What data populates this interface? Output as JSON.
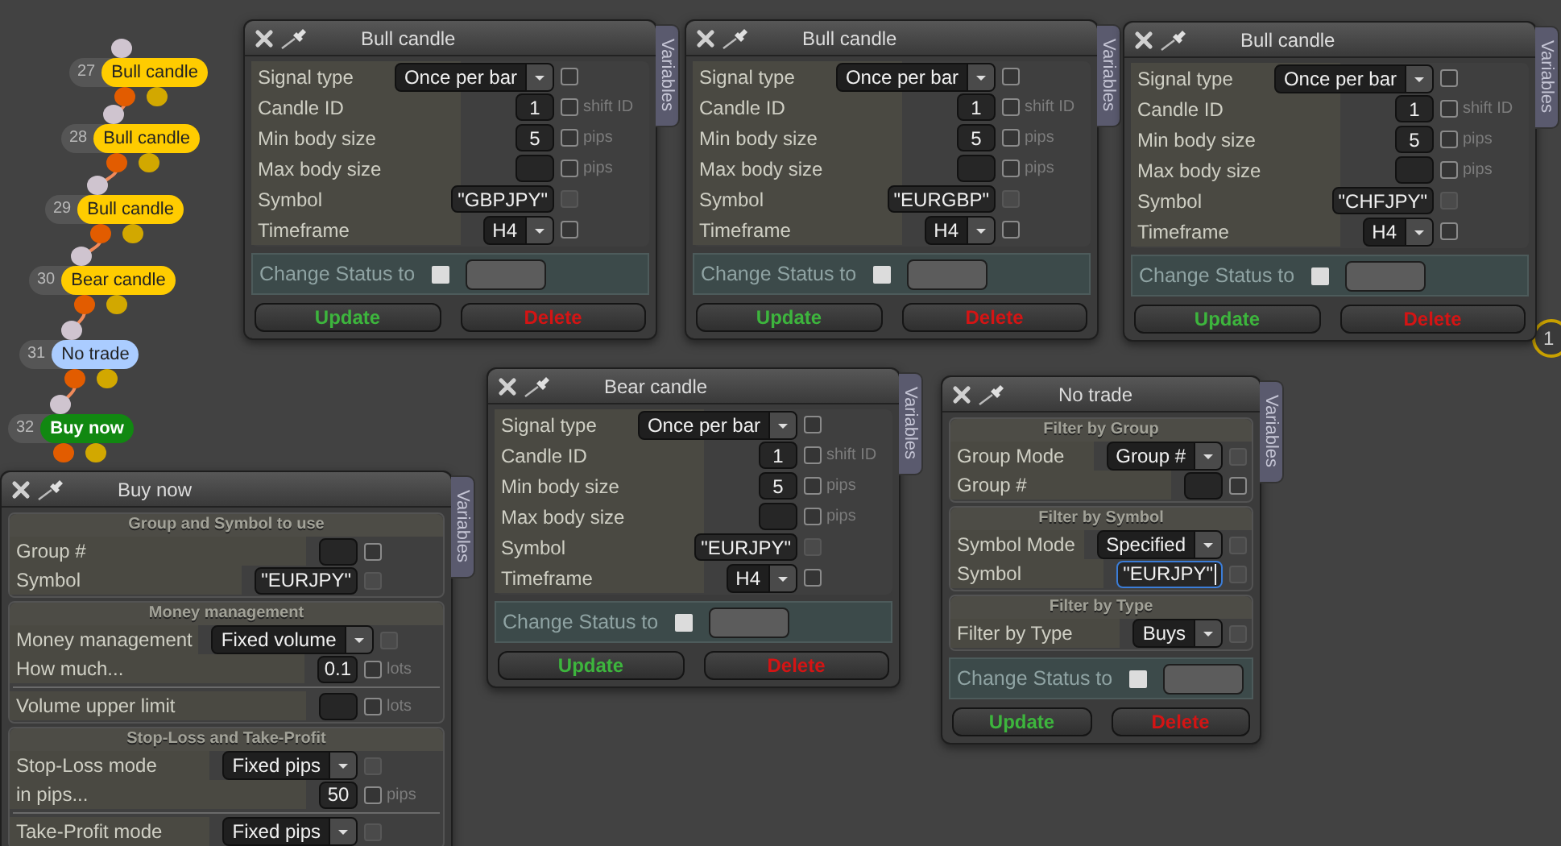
{
  "nodes": [
    {
      "number": "27",
      "label": "Bull candle",
      "color": "#ffcc00"
    },
    {
      "number": "28",
      "label": "Bull candle",
      "color": "#ffcc00"
    },
    {
      "number": "29",
      "label": "Bull candle",
      "color": "#ffcc00"
    },
    {
      "number": "30",
      "label": "Bear candle",
      "color": "#ffcc00"
    },
    {
      "number": "31",
      "label": "No trade",
      "color": "#aaccff"
    },
    {
      "number": "32",
      "label": "Buy now",
      "color": "#118811"
    }
  ],
  "edge_node": {
    "number": "1"
  },
  "windows": [
    {
      "title": "Bull candle",
      "kind": "candle",
      "tab": "Variables",
      "sections": [
        {
          "rows": [
            {
              "kind": "dropdown",
              "label": "Signal type",
              "value": "Once per bar",
              "checked": false,
              "disabled": false
            },
            {
              "kind": "input",
              "label": "Candle ID",
              "value": "1",
              "focused": false,
              "checked": false,
              "disabled": false,
              "unit": "shift ID"
            },
            {
              "kind": "input",
              "label": "Min body size",
              "value": "5",
              "focused": false,
              "checked": false,
              "disabled": false,
              "unit": "pips"
            },
            {
              "kind": "input",
              "label": "Max body size",
              "focused": false,
              "checked": false,
              "disabled": false,
              "unit": "pips"
            },
            {
              "kind": "input",
              "label": "Symbol",
              "value": "\"GBPJPY\"",
              "focused": false,
              "checked": false,
              "disabled": true
            },
            {
              "kind": "dropdown",
              "label": "Timeframe",
              "value": "H4",
              "checked": false,
              "disabled": false
            }
          ]
        }
      ],
      "status": {
        "label": "Change Status to",
        "checked": false
      },
      "buttons": [
        {
          "label": "Update",
          "kind": "update"
        },
        {
          "label": "Delete",
          "kind": "delete"
        }
      ]
    },
    {
      "title": "Bull candle",
      "kind": "candle",
      "tab": "Variables",
      "sections": [
        {
          "rows": [
            {
              "kind": "dropdown",
              "label": "Signal type",
              "value": "Once per bar",
              "checked": false,
              "disabled": false
            },
            {
              "kind": "input",
              "label": "Candle ID",
              "value": "1",
              "focused": false,
              "checked": false,
              "disabled": false,
              "unit": "shift ID"
            },
            {
              "kind": "input",
              "label": "Min body size",
              "value": "5",
              "focused": false,
              "checked": false,
              "disabled": false,
              "unit": "pips"
            },
            {
              "kind": "input",
              "label": "Max body size",
              "focused": false,
              "checked": false,
              "disabled": false,
              "unit": "pips"
            },
            {
              "kind": "input",
              "label": "Symbol",
              "value": "\"EURGBP\"",
              "focused": false,
              "checked": false,
              "disabled": true
            },
            {
              "kind": "dropdown",
              "label": "Timeframe",
              "value": "H4",
              "checked": false,
              "disabled": false
            }
          ]
        }
      ],
      "status": {
        "label": "Change Status to",
        "checked": false
      },
      "buttons": [
        {
          "label": "Update",
          "kind": "update"
        },
        {
          "label": "Delete",
          "kind": "delete"
        }
      ]
    },
    {
      "title": "Bull candle",
      "kind": "candle",
      "tab": "Variables",
      "sections": [
        {
          "rows": [
            {
              "kind": "dropdown",
              "label": "Signal type",
              "value": "Once per bar",
              "checked": false,
              "disabled": false
            },
            {
              "kind": "input",
              "label": "Candle ID",
              "value": "1",
              "focused": false,
              "checked": false,
              "disabled": false,
              "unit": "shift ID"
            },
            {
              "kind": "input",
              "label": "Min body size",
              "value": "5",
              "focused": false,
              "checked": false,
              "disabled": false,
              "unit": "pips"
            },
            {
              "kind": "input",
              "label": "Max body size",
              "focused": false,
              "checked": false,
              "disabled": false,
              "unit": "pips"
            },
            {
              "kind": "input",
              "label": "Symbol",
              "value": "\"CHFJPY\"",
              "focused": false,
              "checked": false,
              "disabled": true
            },
            {
              "kind": "dropdown",
              "label": "Timeframe",
              "value": "H4",
              "checked": false,
              "disabled": false
            }
          ]
        }
      ],
      "status": {
        "label": "Change Status to",
        "checked": false
      },
      "buttons": [
        {
          "label": "Update",
          "kind": "update"
        },
        {
          "label": "Delete",
          "kind": "delete"
        }
      ]
    },
    {
      "title": "Bear candle",
      "kind": "candle",
      "tab": "Variables",
      "sections": [
        {
          "rows": [
            {
              "kind": "dropdown",
              "label": "Signal type",
              "value": "Once per bar",
              "checked": false,
              "disabled": false
            },
            {
              "kind": "input",
              "label": "Candle ID",
              "value": "1",
              "focused": false,
              "checked": false,
              "disabled": false,
              "unit": "shift ID"
            },
            {
              "kind": "input",
              "label": "Min body size",
              "value": "5",
              "focused": false,
              "checked": false,
              "disabled": false,
              "unit": "pips"
            },
            {
              "kind": "input",
              "label": "Max body size",
              "focused": false,
              "checked": false,
              "disabled": false,
              "unit": "pips"
            },
            {
              "kind": "input",
              "label": "Symbol",
              "value": "\"EURJPY\"",
              "focused": false,
              "checked": false,
              "disabled": true
            },
            {
              "kind": "dropdown",
              "label": "Timeframe",
              "value": "H4",
              "checked": false,
              "disabled": false
            }
          ]
        }
      ],
      "status": {
        "label": "Change Status to",
        "checked": false
      },
      "buttons": [
        {
          "label": "Update",
          "kind": "update"
        },
        {
          "label": "Delete",
          "kind": "delete"
        }
      ]
    },
    {
      "title": "No trade",
      "kind": "filter",
      "tab": "Variables",
      "sections": [
        {
          "header": "Filter by Group",
          "rows": [
            {
              "kind": "dropdown",
              "label": "Group Mode",
              "value": "Group #",
              "checked": false,
              "disabled": true
            },
            {
              "kind": "input",
              "label": "Group #",
              "focused": false,
              "checked": false,
              "disabled": false
            }
          ]
        },
        {
          "header": "Filter by Symbol",
          "rows": [
            {
              "kind": "dropdown",
              "label": "Symbol Mode",
              "value": "Specified",
              "checked": false,
              "disabled": true
            },
            {
              "kind": "input",
              "label": "Symbol",
              "value": "\"EURJPY\"",
              "focused": true,
              "checked": false,
              "disabled": true
            }
          ]
        },
        {
          "header": "Filter by Type",
          "rows": [
            {
              "kind": "dropdown",
              "label": "Filter by Type",
              "value": "Buys",
              "checked": false,
              "disabled": true
            }
          ]
        }
      ],
      "status": {
        "label": "Change Status to",
        "checked": false
      },
      "buttons": [
        {
          "label": "Update",
          "kind": "update"
        },
        {
          "label": "Delete",
          "kind": "delete"
        }
      ]
    },
    {
      "title": "Buy now",
      "kind": "order",
      "tab": "Variables",
      "sections": [
        {
          "header": "Group and Symbol to use",
          "rows": [
            {
              "kind": "input",
              "label": "Group #",
              "focused": false,
              "checked": false,
              "disabled": false
            },
            {
              "kind": "input",
              "label": "Symbol",
              "value": "\"EURJPY\"",
              "focused": false,
              "checked": false,
              "disabled": true
            }
          ]
        },
        {
          "header": "Money management",
          "rows": [
            {
              "kind": "dropdown",
              "label": "Money management",
              "value": "Fixed volume",
              "checked": false,
              "disabled": true
            },
            {
              "kind": "input",
              "label": "How much...",
              "value": "0.1",
              "focused": false,
              "checked": false,
              "disabled": false,
              "unit": "lots"
            },
            {
              "kind": "separator"
            },
            {
              "kind": "input",
              "label": "Volume upper limit",
              "focused": false,
              "checked": false,
              "disabled": false,
              "unit": "lots"
            }
          ]
        },
        {
          "header": "Stop-Loss and Take-Profit",
          "rows": [
            {
              "kind": "dropdown",
              "label": "Stop-Loss mode",
              "value": "Fixed pips",
              "checked": false,
              "disabled": true
            },
            {
              "kind": "input",
              "label": "in pips...",
              "value": "50",
              "focused": false,
              "checked": false,
              "disabled": false,
              "unit": "pips"
            },
            {
              "kind": "separator"
            },
            {
              "kind": "dropdown",
              "label": "Take-Profit mode",
              "value": "Fixed pips",
              "checked": false,
              "disabled": true
            }
          ]
        }
      ]
    }
  ]
}
